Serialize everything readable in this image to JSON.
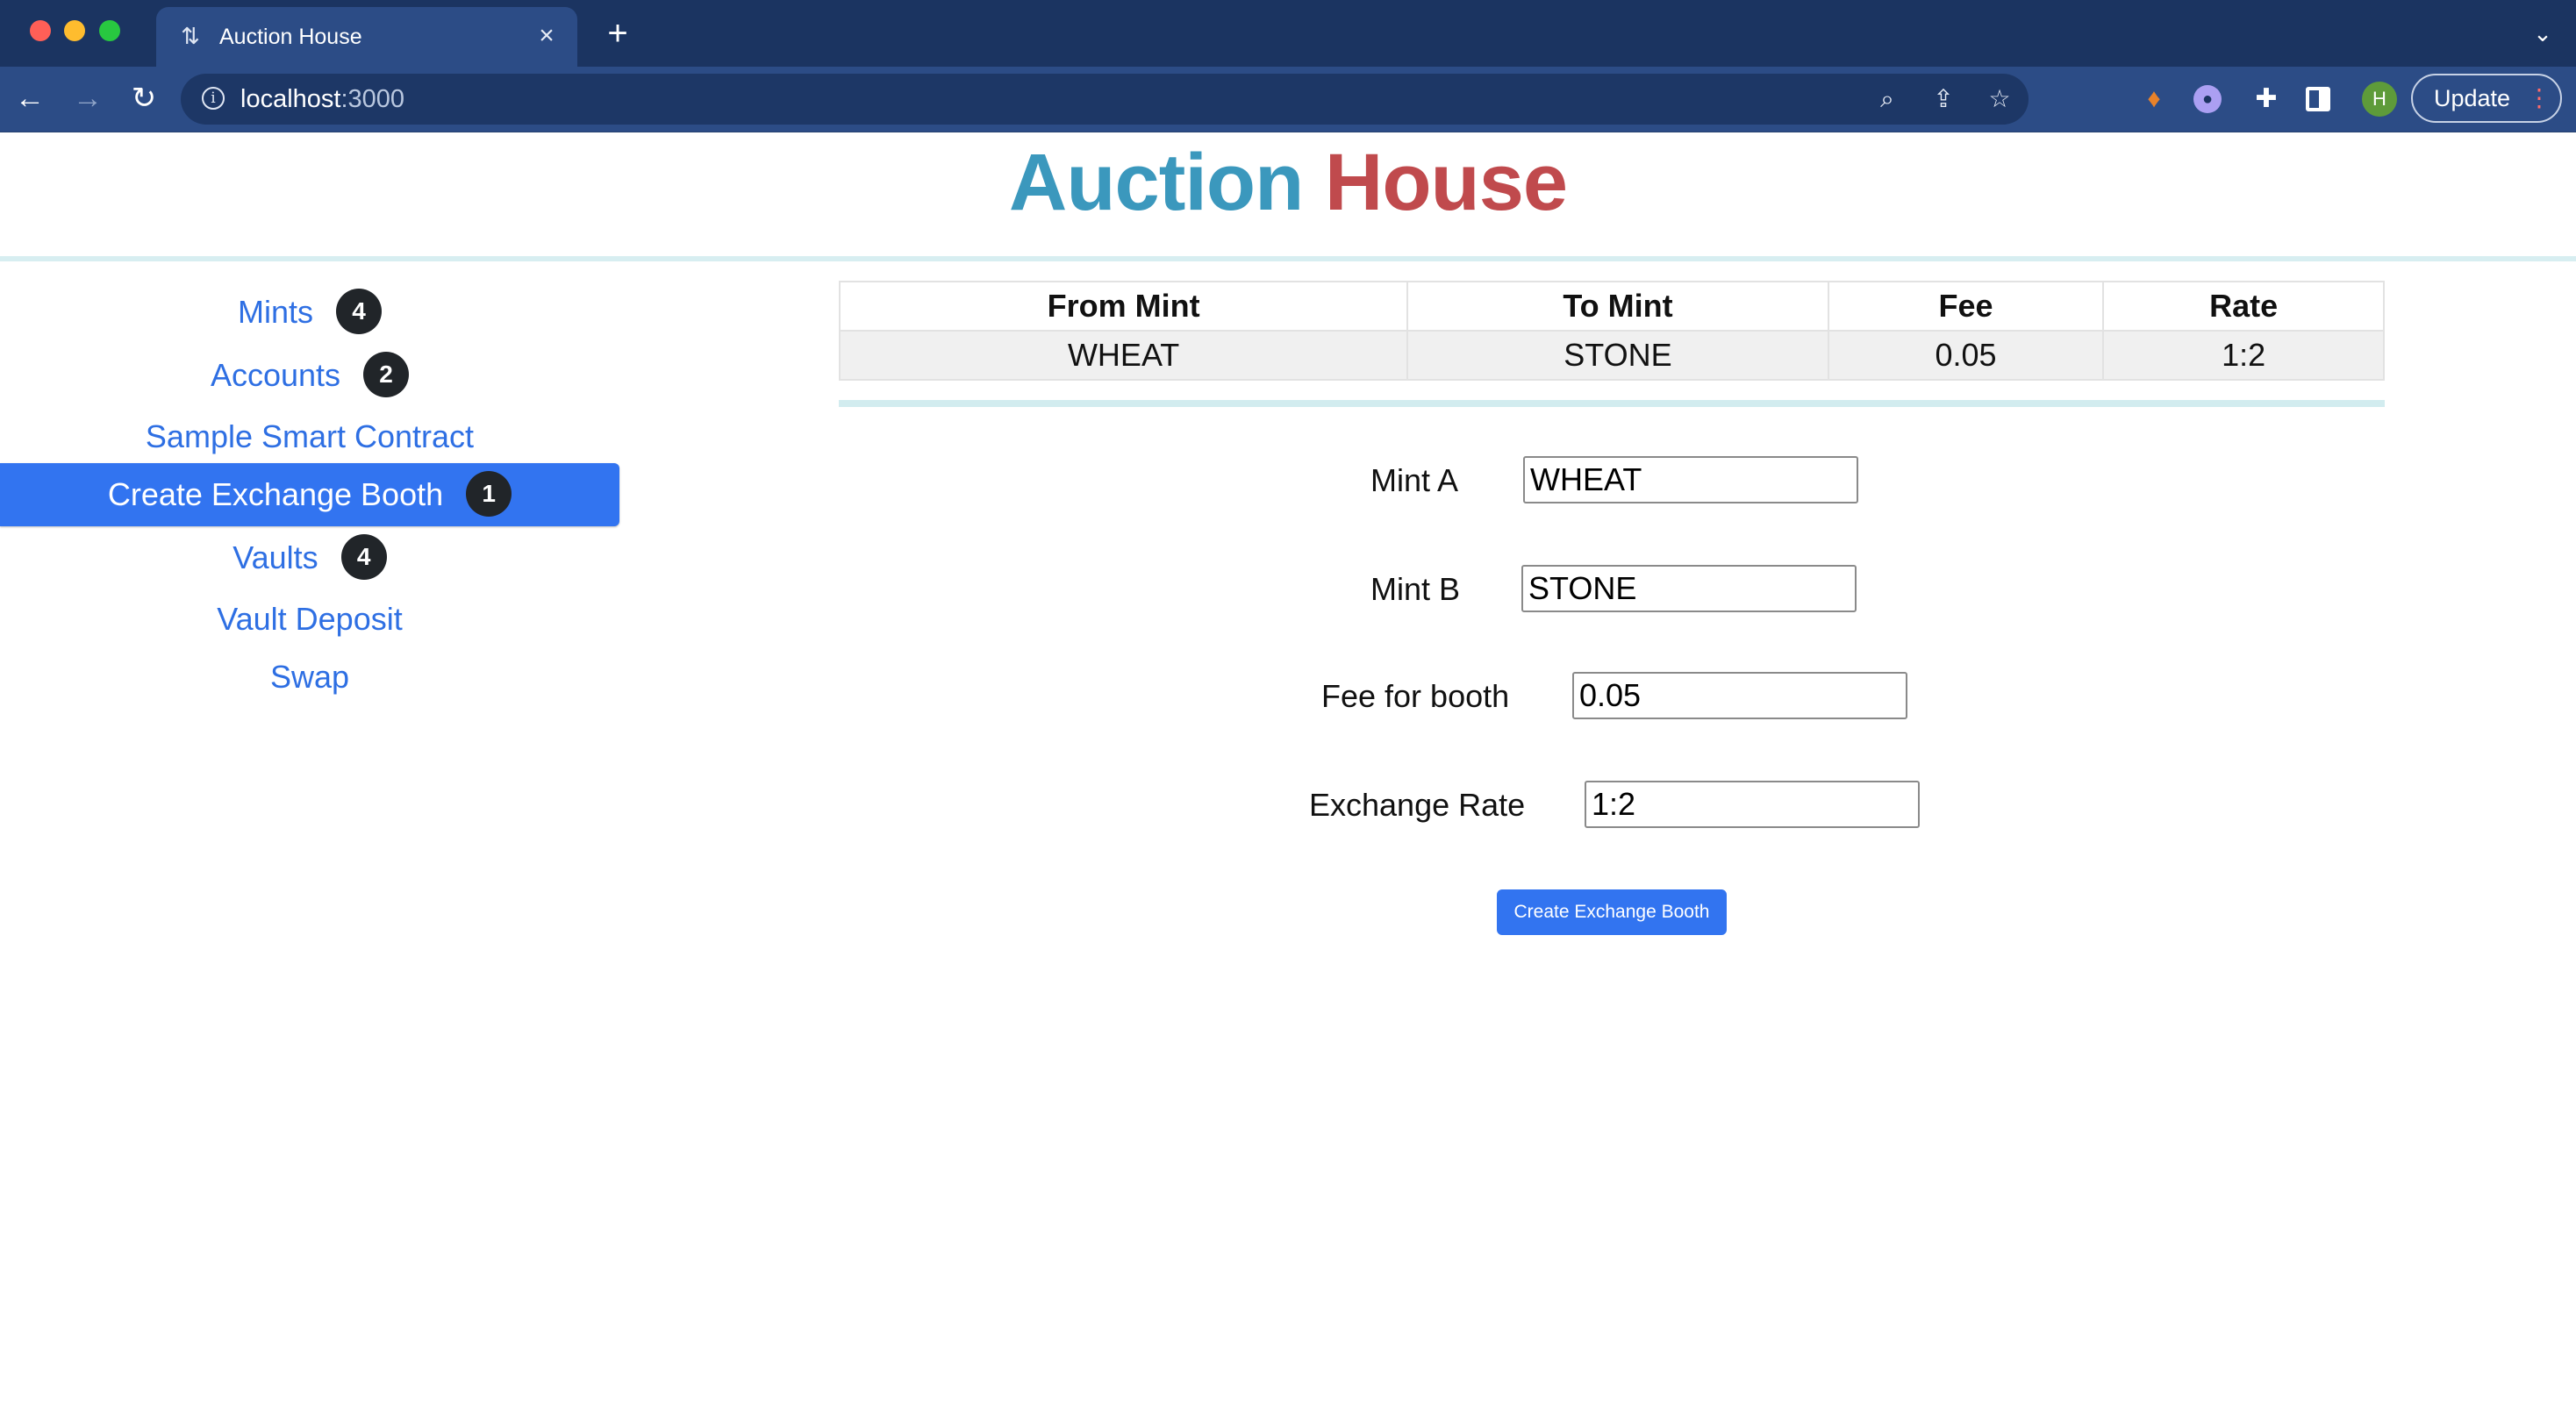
{
  "browser": {
    "tab_title": "Auction House",
    "tab_close": "×",
    "new_tab": "+",
    "url_host": "localhost",
    "url_port": ":3000",
    "profile_initial": "H",
    "update_label": "Update",
    "icons": [
      "back-arrow-icon",
      "forward-arrow-icon",
      "reload-icon",
      "info-icon",
      "zoom-icon",
      "share-icon",
      "star-icon",
      "metamask-icon",
      "phantom-icon",
      "extensions-icon",
      "side-panel-icon"
    ]
  },
  "header": {
    "title_part1": "Auction",
    "title_part2": "House",
    "title_colors": {
      "part1": "#3b98bd",
      "part2": "#c04a4d"
    }
  },
  "sidebar": {
    "items": [
      {
        "label": "Mints",
        "badge": "4",
        "active": false
      },
      {
        "label": "Accounts",
        "badge": "2",
        "active": false
      },
      {
        "label": "Sample Smart Contract",
        "badge": null,
        "active": false
      },
      {
        "label": "Create Exchange Booth",
        "badge": "1",
        "active": true
      },
      {
        "label": "Vaults",
        "badge": "4",
        "active": false
      },
      {
        "label": "Vault Deposit",
        "badge": null,
        "active": false
      },
      {
        "label": "Swap",
        "badge": null,
        "active": false
      }
    ],
    "active_color": "#3274f0"
  },
  "booth_table": {
    "columns": [
      "From Mint",
      "To Mint",
      "Fee",
      "Rate"
    ],
    "rows": [
      [
        "WHEAT",
        "STONE",
        "0.05",
        "1:2"
      ]
    ]
  },
  "form": {
    "mint_a": {
      "label": "Mint A",
      "value": "WHEAT"
    },
    "mint_b": {
      "label": "Mint B",
      "value": "STONE"
    },
    "fee": {
      "label": "Fee for booth",
      "value": "0.05"
    },
    "rate": {
      "label": "Exchange Rate",
      "value": "1:2"
    },
    "submit_label": "Create Exchange Booth"
  }
}
